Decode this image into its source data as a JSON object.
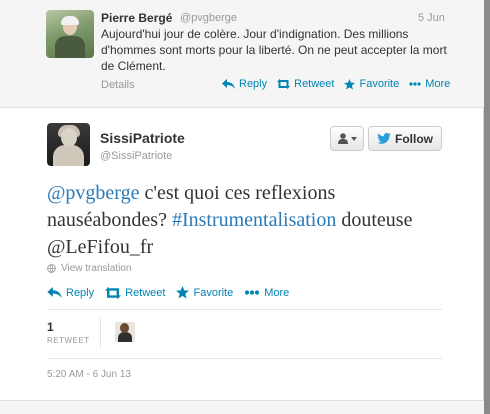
{
  "context_tweet": {
    "name": "Pierre Bergé",
    "handle": "@pvgberge",
    "time": "5 Jun",
    "text": "Aujourd'hui jour de colère. Jour d'indignation. Des millions d'hommes sont morts pour la liberté. On ne peut accepter la mort de Clément.",
    "details_label": "Details",
    "actions": {
      "reply": "Reply",
      "retweet": "Retweet",
      "favorite": "Favorite",
      "more": "More"
    }
  },
  "main_tweet": {
    "name": "SissiPatriote",
    "handle": "@SissiPatriote",
    "follow_label": "Follow",
    "text_parts": {
      "mention": "@pvgberge",
      "part1": " c'est quoi ces reflexions nauséabondes? ",
      "hashtag": "#Instrumentalisation",
      "part2": " douteuse @LeFifou_fr"
    },
    "view_translation": "View translation",
    "actions": {
      "reply": "Reply",
      "retweet": "Retweet",
      "favorite": "Favorite",
      "more": "More"
    },
    "retweet_count": "1",
    "retweet_label": "RETWEET",
    "timestamp": "5:20 AM - 6 Jun 13"
  },
  "colors": {
    "link": "#0084b4",
    "hashtag": "#2a7ab8",
    "muted": "#999999",
    "text": "#333333"
  }
}
